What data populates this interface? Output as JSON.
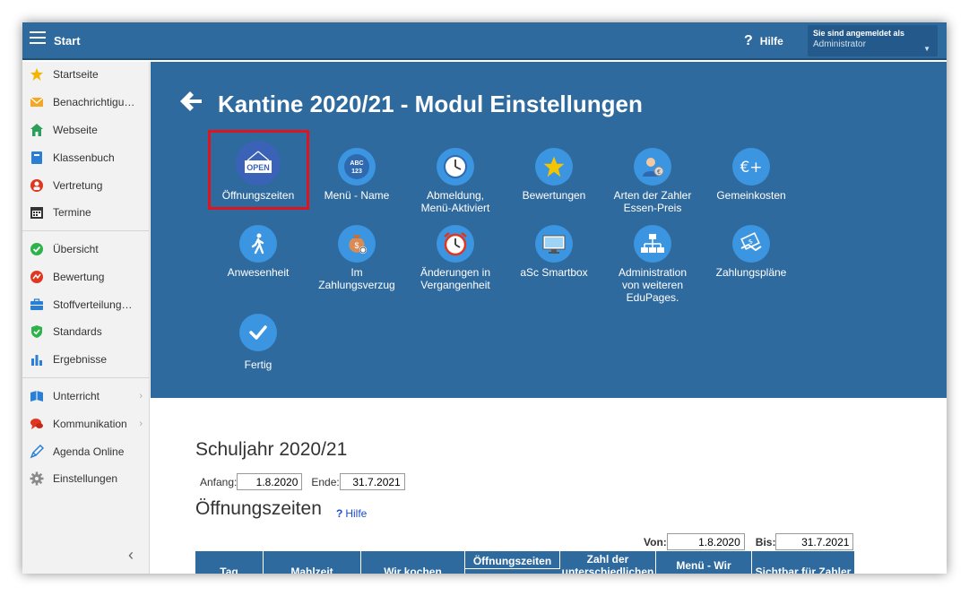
{
  "topbar": {
    "start_label": "Start",
    "help_label": "Hilfe",
    "user_line1": "Sie sind angemeldet als",
    "user_line2": "Administrator"
  },
  "sidebar": {
    "items": [
      {
        "label": "Startseite",
        "icon": "star-icon"
      },
      {
        "label": "Benachrichtigungen",
        "icon": "envelope-icon"
      },
      {
        "label": "Webseite",
        "icon": "house-icon"
      },
      {
        "label": "Klassenbuch",
        "icon": "book-icon"
      },
      {
        "label": "Vertretung",
        "icon": "person-swap-icon"
      },
      {
        "label": "Termine",
        "icon": "calendar-icon"
      },
      {
        "label": "Übersicht",
        "icon": "check-circle-icon"
      },
      {
        "label": "Bewertung",
        "icon": "grade-icon"
      },
      {
        "label": "Stoffverteilungsplan",
        "icon": "briefcase-icon"
      },
      {
        "label": "Standards",
        "icon": "shield-icon"
      },
      {
        "label": "Ergebnisse",
        "icon": "bar-chart-icon"
      },
      {
        "label": "Unterricht",
        "icon": "open-book-icon"
      },
      {
        "label": "Kommunikation",
        "icon": "chat-icon"
      },
      {
        "label": "Agenda Online",
        "icon": "pen-icon"
      },
      {
        "label": "Einstellungen",
        "icon": "gear-icon"
      }
    ]
  },
  "header": {
    "title": "Kantine 2020/21 - Modul Einstellungen"
  },
  "tiles": [
    {
      "label1": "Öffnungszeiten",
      "label2": "",
      "label3": "",
      "icon": "open-sign-icon"
    },
    {
      "label1": "Menü - Name",
      "label2": "",
      "label3": "",
      "icon": "abc-123-icon"
    },
    {
      "label1": "Abmeldung,",
      "label2": "Menü-Aktiviert",
      "label3": "",
      "icon": "clock-icon"
    },
    {
      "label1": "Bewertungen",
      "label2": "",
      "label3": "",
      "icon": "star-icon"
    },
    {
      "label1": "Arten der Zahler",
      "label2": "Essen-Preis",
      "label3": "",
      "icon": "payer-icon"
    },
    {
      "label1": "Gemeinkosten",
      "label2": "",
      "label3": "",
      "icon": "euro-plus-icon"
    },
    {
      "label1": "Anwesenheit",
      "label2": "",
      "label3": "",
      "icon": "walking-person-icon"
    },
    {
      "label1": "Im",
      "label2": "Zahlungsverzug",
      "label3": "",
      "icon": "money-bag-icon"
    },
    {
      "label1": "Änderungen in",
      "label2": "Vergangenheit",
      "label3": "",
      "icon": "alarm-clock-icon"
    },
    {
      "label1": "aSc Smartbox",
      "label2": "",
      "label3": "",
      "icon": "monitor-icon"
    },
    {
      "label1": "Administration",
      "label2": "von weiteren",
      "label3": "EduPages.",
      "icon": "hierarchy-icon"
    },
    {
      "label1": "Zahlungspläne",
      "label2": "",
      "label3": "",
      "icon": "handshake-icon"
    },
    {
      "label1": "Fertig",
      "label2": "",
      "label3": "",
      "icon": "checkmark-icon"
    }
  ],
  "schoolyear": {
    "heading": "Schuljahr 2020/21",
    "start_label": "Anfang:",
    "start_value": "1.8.2020",
    "end_label": "Ende:",
    "end_value": "31.7.2021"
  },
  "opening": {
    "heading": "Öffnungszeiten",
    "help_link": "Hilfe",
    "from_label": "Von:",
    "from_value": "1.8.2020",
    "to_label": "Bis:",
    "to_value": "31.7.2021"
  },
  "table": {
    "columns": [
      "Tag",
      "Mahlzeit",
      "Wir kochen",
      "Öffnungszeiten",
      "Zahl der unterschiedlichen",
      "Menü - Wir",
      "Sichtbar für Zahler"
    ]
  }
}
